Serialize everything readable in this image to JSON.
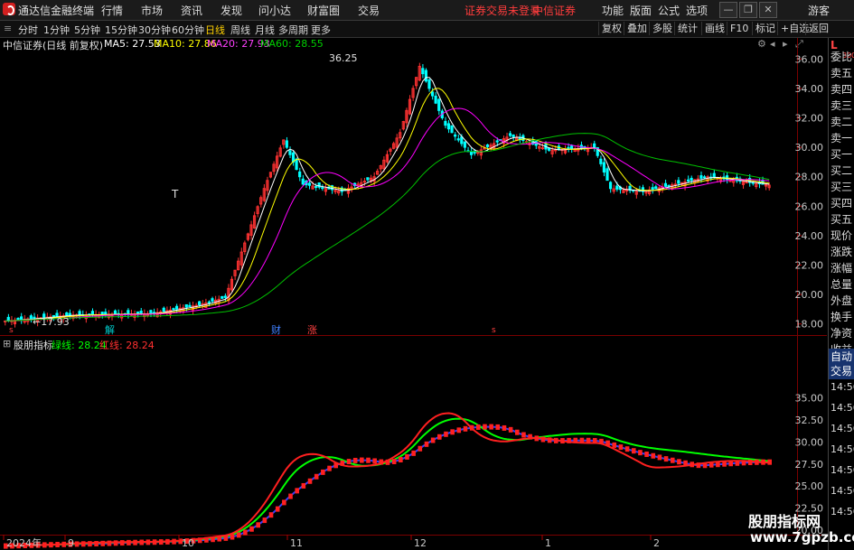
{
  "menubar": {
    "app_title": "通达信金融终端",
    "items": [
      "行情",
      "市场",
      "资讯",
      "发现",
      "问小达",
      "财富圈",
      "交易"
    ],
    "warning": "证券交易未登录",
    "broker": "中信证券",
    "right_items": [
      "功能",
      "版面",
      "公式",
      "选项"
    ],
    "guest": "游客"
  },
  "tabbar": {
    "periods": [
      "分时",
      "1分钟",
      "5分钟",
      "15分钟",
      "30分钟",
      "60分钟",
      "日线",
      "周线",
      "月线",
      "多周期",
      "更多"
    ],
    "active": "日线",
    "tools": [
      "复权",
      "叠加",
      "多股",
      "统计",
      "画线",
      "F10",
      "标记",
      "+自选",
      "返回"
    ]
  },
  "legend": {
    "stock": "中信证券(日线 前复权)",
    "ma5": "MA5: 27.53",
    "ma10": "MA10: 27.86",
    "ma20": "MA20: 27.93",
    "ma60": "MA60: 28.55"
  },
  "price_axis": [
    "36.00",
    "34.00",
    "32.00",
    "30.00",
    "28.00",
    "26.00",
    "24.00",
    "22.00",
    "20.00",
    "18.00"
  ],
  "annotations": {
    "high": "36.25",
    "low": "17.93",
    "t_mark": "T"
  },
  "event_marks": [
    "解",
    "财",
    "涨"
  ],
  "indicator": {
    "name": "股朋指标",
    "green_label": "绿线: 28.24",
    "red_label": "红线: 28.24",
    "axis": [
      "35.00",
      "32.50",
      "30.00",
      "27.50",
      "25.00",
      "22.50",
      "20.00"
    ]
  },
  "time_axis": [
    "2024年",
    "9",
    "10",
    "11",
    "12",
    "1",
    "2"
  ],
  "right_panel": {
    "l_label": "L",
    "l_num": "300",
    "items": [
      "委比",
      "卖五",
      "卖四",
      "卖三",
      "卖二",
      "卖一",
      "买一",
      "买二",
      "买三",
      "买四",
      "买五",
      "现价",
      "涨跌",
      "涨幅",
      "总量",
      "外盘",
      "换手",
      "净资",
      "收益"
    ],
    "auto": "自动",
    "trade": "交易",
    "times": [
      "14:56",
      "14:56",
      "14:56",
      "14:56",
      "14:56",
      "14:56",
      "14:56"
    ]
  },
  "watermark": {
    "line1": "股朋指标网",
    "line2": "www.7gpzb.com"
  },
  "colors": {
    "up": "#ff3232",
    "down": "#00ffff",
    "ma5": "#ffffff",
    "ma10": "#ffff00",
    "ma20": "#ff00ff",
    "ma60": "#00c000",
    "green_line": "#00ff00",
    "red_line": "#ff2020",
    "blue_line": "#3040ff"
  }
}
